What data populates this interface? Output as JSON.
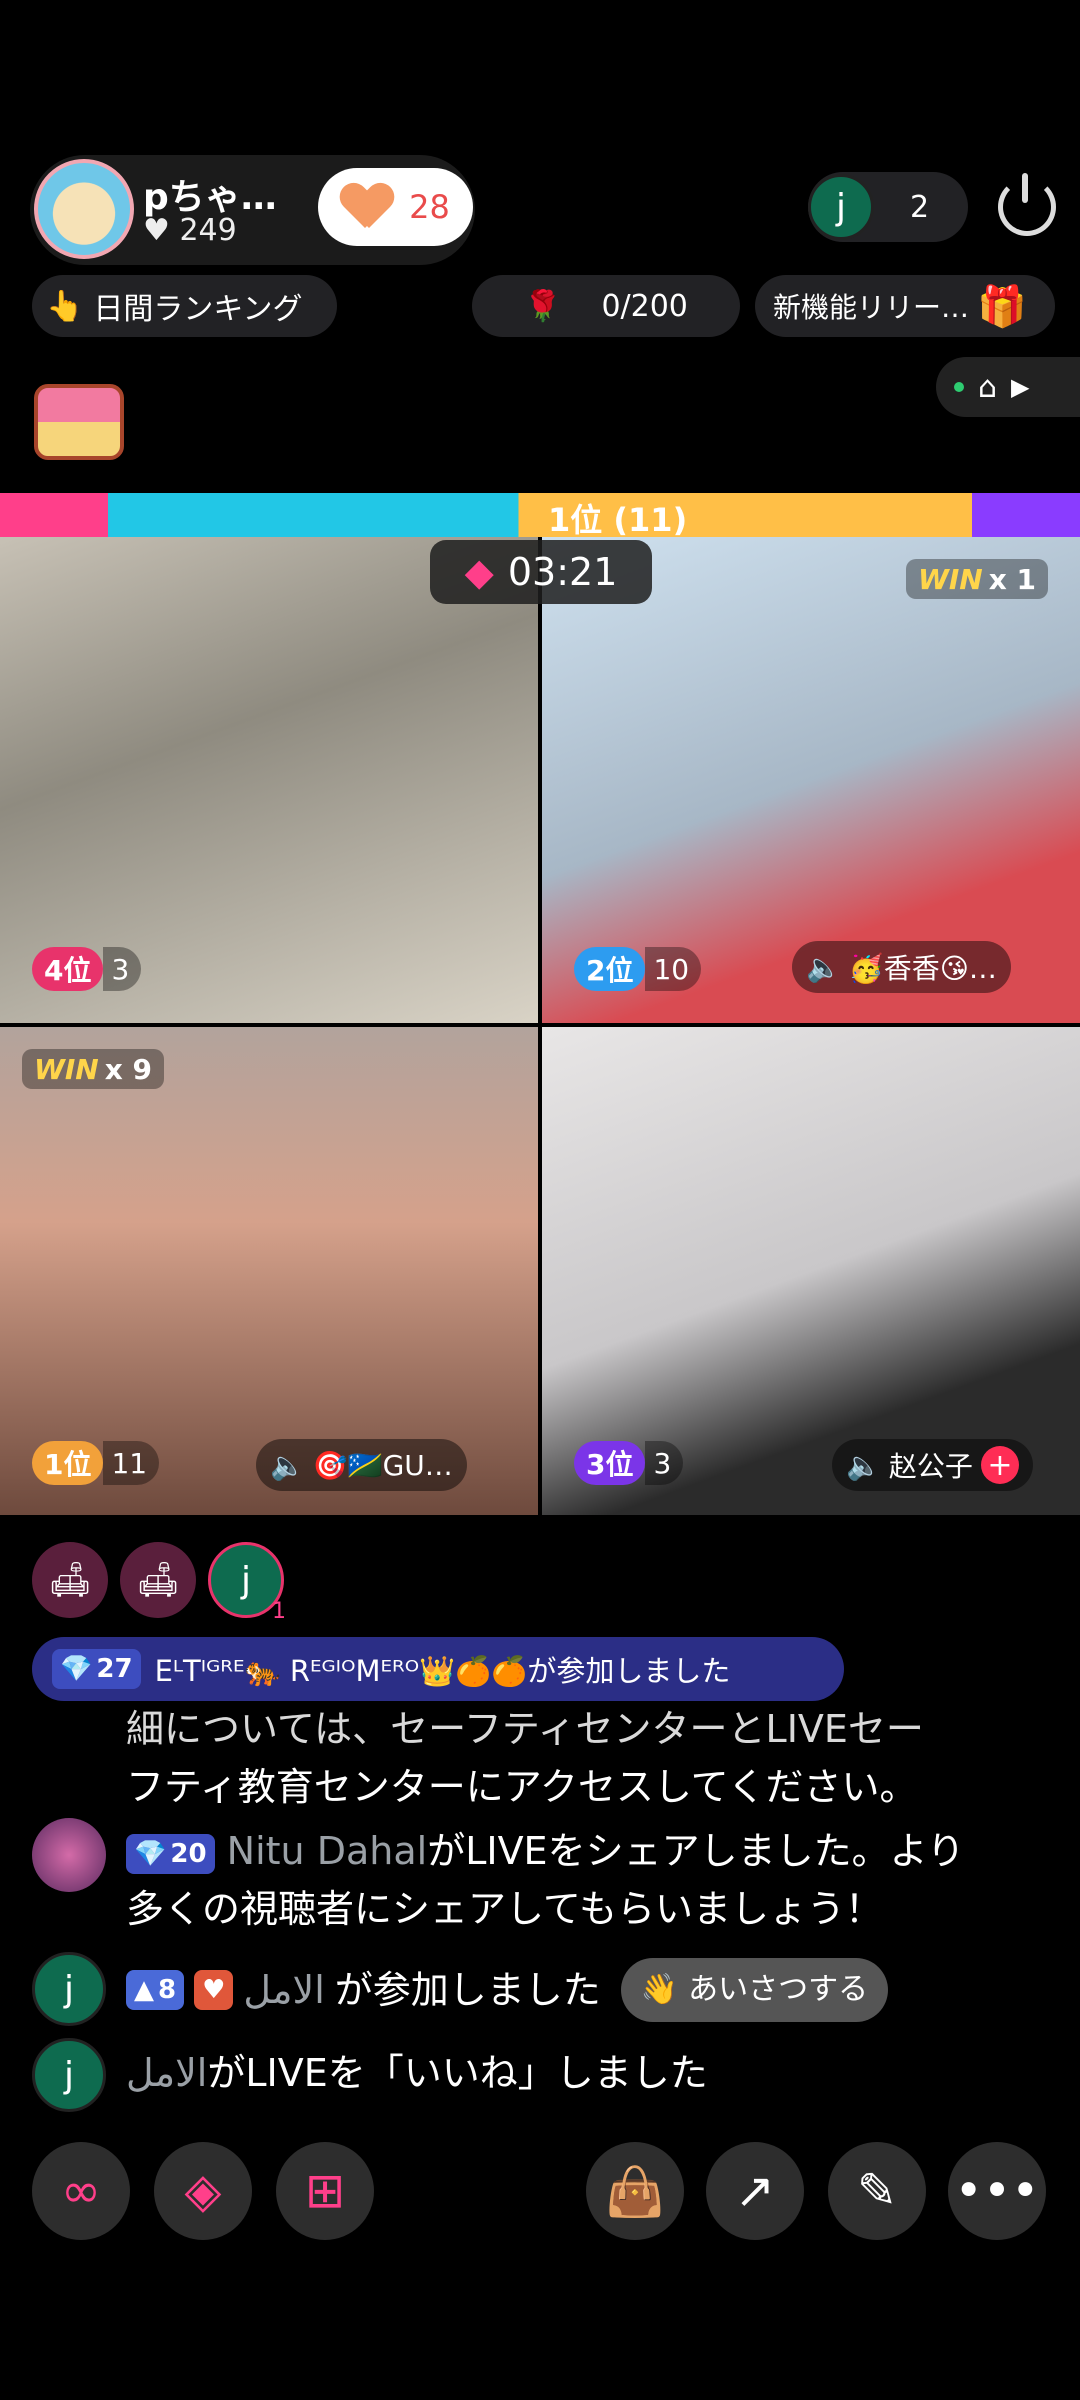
{
  "header": {
    "host_name": "pちゃ…",
    "host_likes": "249",
    "like_count": "28",
    "viewer_initial": "j",
    "viewer_count": "2"
  },
  "ranking": {
    "label": "日間ランキング"
  },
  "gift_goal": {
    "value": "0/200"
  },
  "new_feature": {
    "label": "新機能リリー…"
  },
  "battle": {
    "bar_label": "1位 (11)",
    "timer": "03:21"
  },
  "tiles": [
    {
      "rank": "4位",
      "score": "3",
      "win": "",
      "mic": ""
    },
    {
      "rank": "2位",
      "score": "10",
      "win": "x 1",
      "mic": "🥳香香😘…"
    },
    {
      "rank": "1位",
      "score": "11",
      "win": "x 9",
      "mic": "🎯🇸🇧GU…"
    },
    {
      "rank": "3位",
      "score": "3",
      "win": "",
      "mic": "赵公子"
    }
  ],
  "win_word": "WIN",
  "seats": {
    "viewer_initial": "j",
    "viewer_badge": "1"
  },
  "join_banner": {
    "level": "27",
    "text": "EᴸTᴵᴳᴿᴱ🐅 RᴱᴳᴵᴼMᴱᴿᴼ👑🍊🍊が参加しました"
  },
  "chat": {
    "system_line1": "細については、セーフティセンターとLIVEセー",
    "system_line2": "フティ教育センターにアクセスしてください。",
    "msg1": {
      "level": "20",
      "user": "Nitu Dahal",
      "text1": "がLIVEをシェアしました。より",
      "text2": "多くの視聴者にシェアしてもらいましょう！"
    },
    "msg2": {
      "avatar": "j",
      "level": "8",
      "user": "الامل",
      "text": "が参加しました",
      "greet": "あいさつする"
    },
    "msg3": {
      "avatar": "j",
      "user": "الامل",
      "text": "がLIVEを「いいね」しました"
    }
  }
}
